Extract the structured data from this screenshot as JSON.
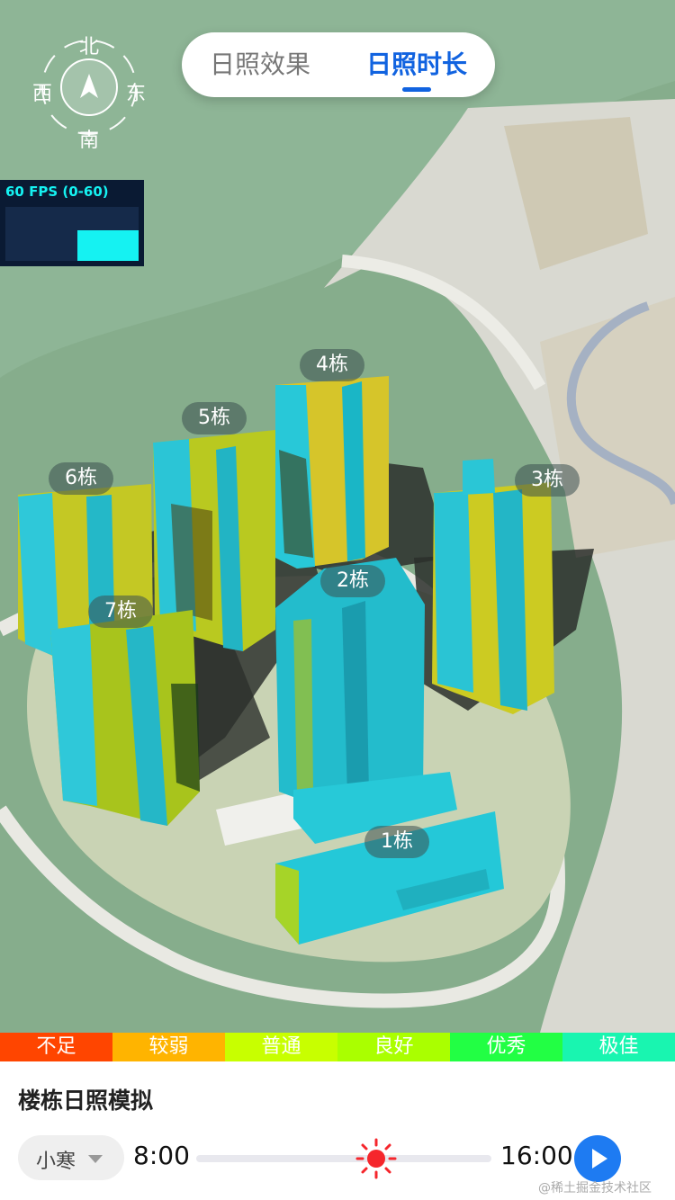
{
  "tabs": [
    {
      "label": "日照效果",
      "active": false
    },
    {
      "label": "日照时长",
      "active": true
    }
  ],
  "compass": {
    "north": "北",
    "east": "东",
    "south": "南",
    "west": "西"
  },
  "fps": {
    "text": "60 FPS (0-60)"
  },
  "buildings": [
    "1栋",
    "2栋",
    "3栋",
    "4栋",
    "5栋",
    "6栋",
    "7栋"
  ],
  "legend": [
    {
      "label": "不足",
      "color": "#ff4500"
    },
    {
      "label": "较弱",
      "color": "#ffb400"
    },
    {
      "label": "普通",
      "color": "#c8ff00"
    },
    {
      "label": "良好",
      "color": "#aaff00"
    },
    {
      "label": "优秀",
      "color": "#22ff44"
    },
    {
      "label": "极佳",
      "color": "#19f5b0"
    }
  ],
  "panel": {
    "title": "楼栋日照模拟",
    "solar_term": "小寒",
    "start_time": "8:00",
    "end_time": "16:00",
    "current_position": 0.61,
    "watermark": "@稀土掘金技术社区"
  }
}
